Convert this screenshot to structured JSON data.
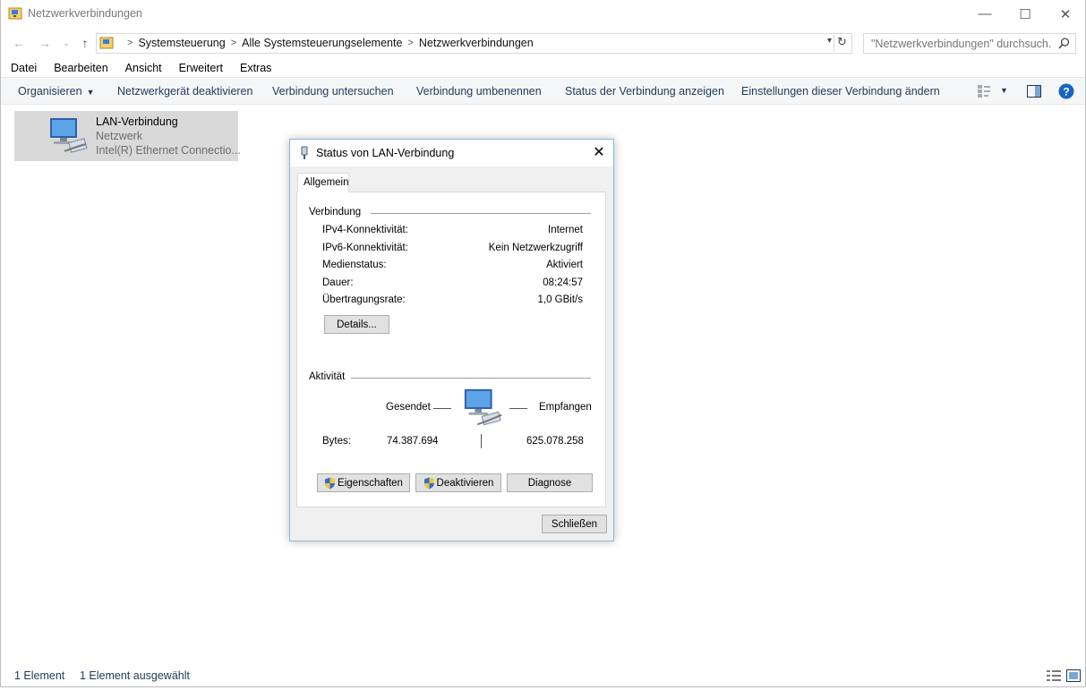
{
  "window": {
    "title": "Netzwerkverbindungen",
    "controls": {
      "minimize": "—",
      "maximize": "☐",
      "close": "✕"
    }
  },
  "address": {
    "breadcrumbs": [
      "Systemsteuerung",
      "Alle Systemsteuerungselemente",
      "Netzwerkverbindungen"
    ],
    "search_placeholder": "\"Netzwerkverbindungen\" durchsuch..."
  },
  "menu": [
    "Datei",
    "Bearbeiten",
    "Ansicht",
    "Erweitert",
    "Extras"
  ],
  "commands": {
    "organize": "Organisieren",
    "disable_device": "Netzwerkgerät deaktivieren",
    "diagnose": "Verbindung untersuchen",
    "rename": "Verbindung umbenennen",
    "status": "Status der Verbindung anzeigen",
    "settings": "Einstellungen dieser Verbindung ändern"
  },
  "connection_item": {
    "name": "LAN-Verbindung",
    "network": "Netzwerk",
    "adapter": "Intel(R) Ethernet Connectio..."
  },
  "statusbar": {
    "count": "1 Element",
    "selected": "1 Element ausgewählt"
  },
  "dialog": {
    "title": "Status von LAN-Verbindung",
    "tab": "Allgemein",
    "connection_group": "Verbindung",
    "rows": [
      {
        "label": "IPv4-Konnektivität:",
        "value": "Internet"
      },
      {
        "label": "IPv6-Konnektivität:",
        "value": "Kein Netzwerkzugriff"
      },
      {
        "label": "Medienstatus:",
        "value": "Aktiviert"
      },
      {
        "label": "Dauer:",
        "value": "08:24:57"
      },
      {
        "label": "Übertragungsrate:",
        "value": "1,0 GBit/s"
      }
    ],
    "details_button": "Details...",
    "activity_group": "Aktivität",
    "sent_label": "Gesendet",
    "received_label": "Empfangen",
    "bytes_label": "Bytes:",
    "bytes_sent": "74.387.694",
    "bytes_received": "625.078.258",
    "properties_button": "Eigenschaften",
    "deactivate_button": "Deaktivieren",
    "diagnose_button": "Diagnose",
    "close_button": "Schließen"
  }
}
